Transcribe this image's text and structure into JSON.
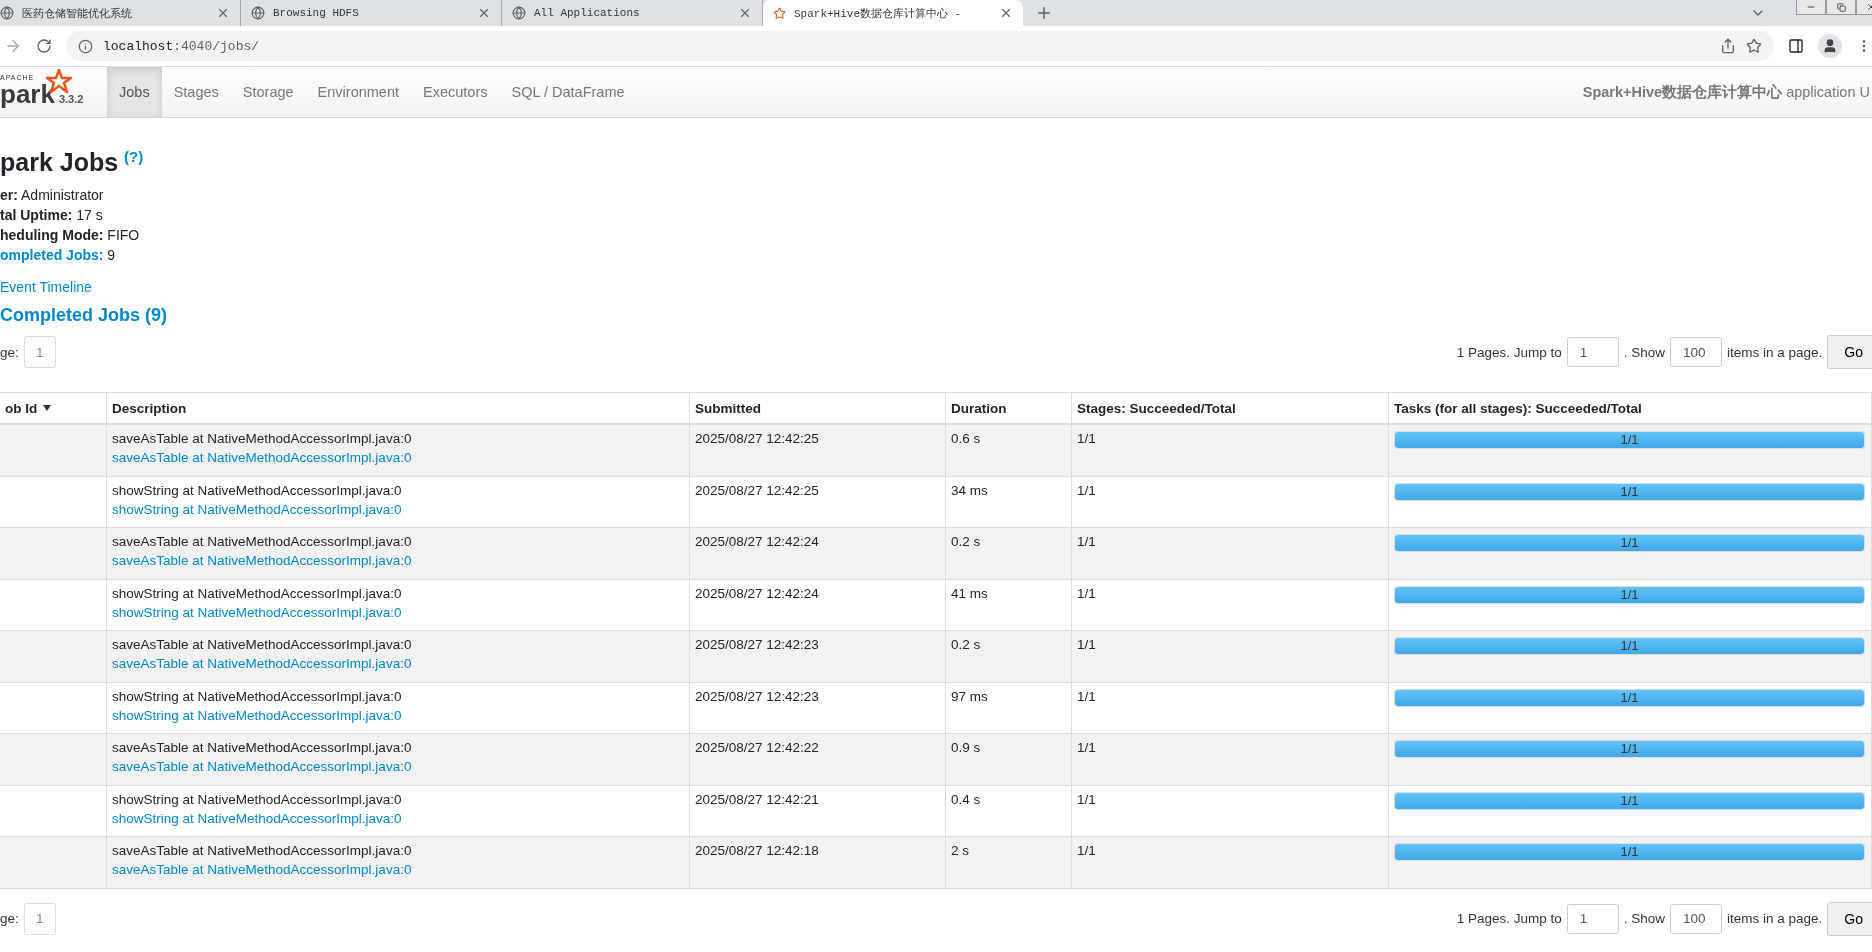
{
  "browser": {
    "tabs": [
      {
        "title": "医药仓储智能优化系统",
        "selected": false
      },
      {
        "title": "Browsing HDFS",
        "selected": false
      },
      {
        "title": "All Applications",
        "selected": false
      },
      {
        "title": "Spark+Hive数据仓库计算中心 -",
        "selected": true
      }
    ],
    "url_host": "localhost",
    "url_rest": ":4040/jobs/"
  },
  "navbar": {
    "logo_small": "APACHE",
    "logo_word": "park",
    "version": "3.3.2",
    "tabs": [
      {
        "label": "Jobs",
        "selected": true
      },
      {
        "label": "Stages",
        "selected": false
      },
      {
        "label": "Storage",
        "selected": false
      },
      {
        "label": "Environment",
        "selected": false
      },
      {
        "label": "Executors",
        "selected": false
      },
      {
        "label": "SQL / DataFrame",
        "selected": false
      }
    ],
    "app_name": "Spark+Hive数据仓库计算中心",
    "app_suffix": "application U"
  },
  "page": {
    "title": "park Jobs",
    "help": "(?)",
    "summary": [
      {
        "label": "er:",
        "value": "Administrator",
        "kind": "plain"
      },
      {
        "label": "tal Uptime:",
        "value": "17 s",
        "kind": "plain"
      },
      {
        "label": "heduling Mode:",
        "value": "FIFO",
        "kind": "plain"
      },
      {
        "label": "ompleted Jobs:",
        "value": "9",
        "kind": "link"
      }
    ],
    "timeline_link": "Event Timeline",
    "section_title": "Completed Jobs (9)"
  },
  "pagination_top": {
    "page_label": "ge:",
    "page": "1",
    "pages_text": "1 Pages. Jump to",
    "jump_value": "1",
    "show_text": ". Show",
    "show_value": "100",
    "items_text": "items in a page.",
    "go": "Go"
  },
  "table": {
    "columns": [
      {
        "label": "ob Id",
        "sorted": true
      },
      {
        "label": "Description",
        "sorted": false
      },
      {
        "label": "Submitted",
        "sorted": false
      },
      {
        "label": "Duration",
        "sorted": false
      },
      {
        "label": "Stages: Succeeded/Total",
        "sorted": false
      },
      {
        "label": "Tasks (for all stages): Succeeded/Total",
        "sorted": false
      }
    ],
    "rows": [
      {
        "description": "saveAsTable at NativeMethodAccessorImpl.java:0",
        "link": "saveAsTable at NativeMethodAccessorImpl.java:0",
        "submitted": "2025/08/27 12:42:25",
        "duration": "0.6 s",
        "stages": "1/1",
        "tasks": "1/1",
        "level": 1
      },
      {
        "description": "showString at NativeMethodAccessorImpl.java:0",
        "link": "showString at NativeMethodAccessorImpl.java:0",
        "submitted": "2025/08/27 12:42:25",
        "duration": "34 ms",
        "stages": "1/1",
        "tasks": "1/1",
        "level": 1
      },
      {
        "description": "saveAsTable at NativeMethodAccessorImpl.java:0",
        "link": "saveAsTable at NativeMethodAccessorImpl.java:0",
        "submitted": "2025/08/27 12:42:24",
        "duration": "0.2 s",
        "stages": "1/1",
        "tasks": "1/1",
        "level": 1
      },
      {
        "description": "showString at NativeMethodAccessorImpl.java:0",
        "link": "showString at NativeMethodAccessorImpl.java:0",
        "submitted": "2025/08/27 12:42:24",
        "duration": "41 ms",
        "stages": "1/1",
        "tasks": "1/1",
        "level": 1
      },
      {
        "description": "saveAsTable at NativeMethodAccessorImpl.java:0",
        "link": "saveAsTable at NativeMethodAccessorImpl.java:0",
        "submitted": "2025/08/27 12:42:23",
        "duration": "0.2 s",
        "stages": "1/1",
        "tasks": "1/1",
        "level": 1
      },
      {
        "description": "showString at NativeMethodAccessorImpl.java:0",
        "link": "showString at NativeMethodAccessorImpl.java:0",
        "submitted": "2025/08/27 12:42:23",
        "duration": "97 ms",
        "stages": "1/1",
        "tasks": "1/1",
        "level": 1
      },
      {
        "description": "saveAsTable at NativeMethodAccessorImpl.java:0",
        "link": "saveAsTable at NativeMethodAccessorImpl.java:0",
        "submitted": "2025/08/27 12:42:22",
        "duration": "0.9 s",
        "stages": "1/1",
        "tasks": "1/1",
        "level": 1
      },
      {
        "description": "showString at NativeMethodAccessorImpl.java:0",
        "link": "showString at NativeMethodAccessorImpl.java:0",
        "submitted": "2025/08/27 12:42:21",
        "duration": "0.4 s",
        "stages": "1/1",
        "tasks": "1/1",
        "level": 1
      },
      {
        "description": "saveAsTable at NativeMethodAccessorImpl.java:0",
        "link": "saveAsTable at NativeMethodAccessorImpl.java:0",
        "submitted": "2025/08/27 12:42:18",
        "duration": "2 s",
        "stages": "1/1",
        "tasks": "1/1",
        "level": 1
      }
    ]
  },
  "pagination_bottom": {
    "page_label": "ge:",
    "page": "1",
    "pages_text": "1 Pages. Jump to",
    "jump_value": "1",
    "show_text": ". Show",
    "show_value": "100",
    "items_text": "items in a page.",
    "go": "Go"
  }
}
